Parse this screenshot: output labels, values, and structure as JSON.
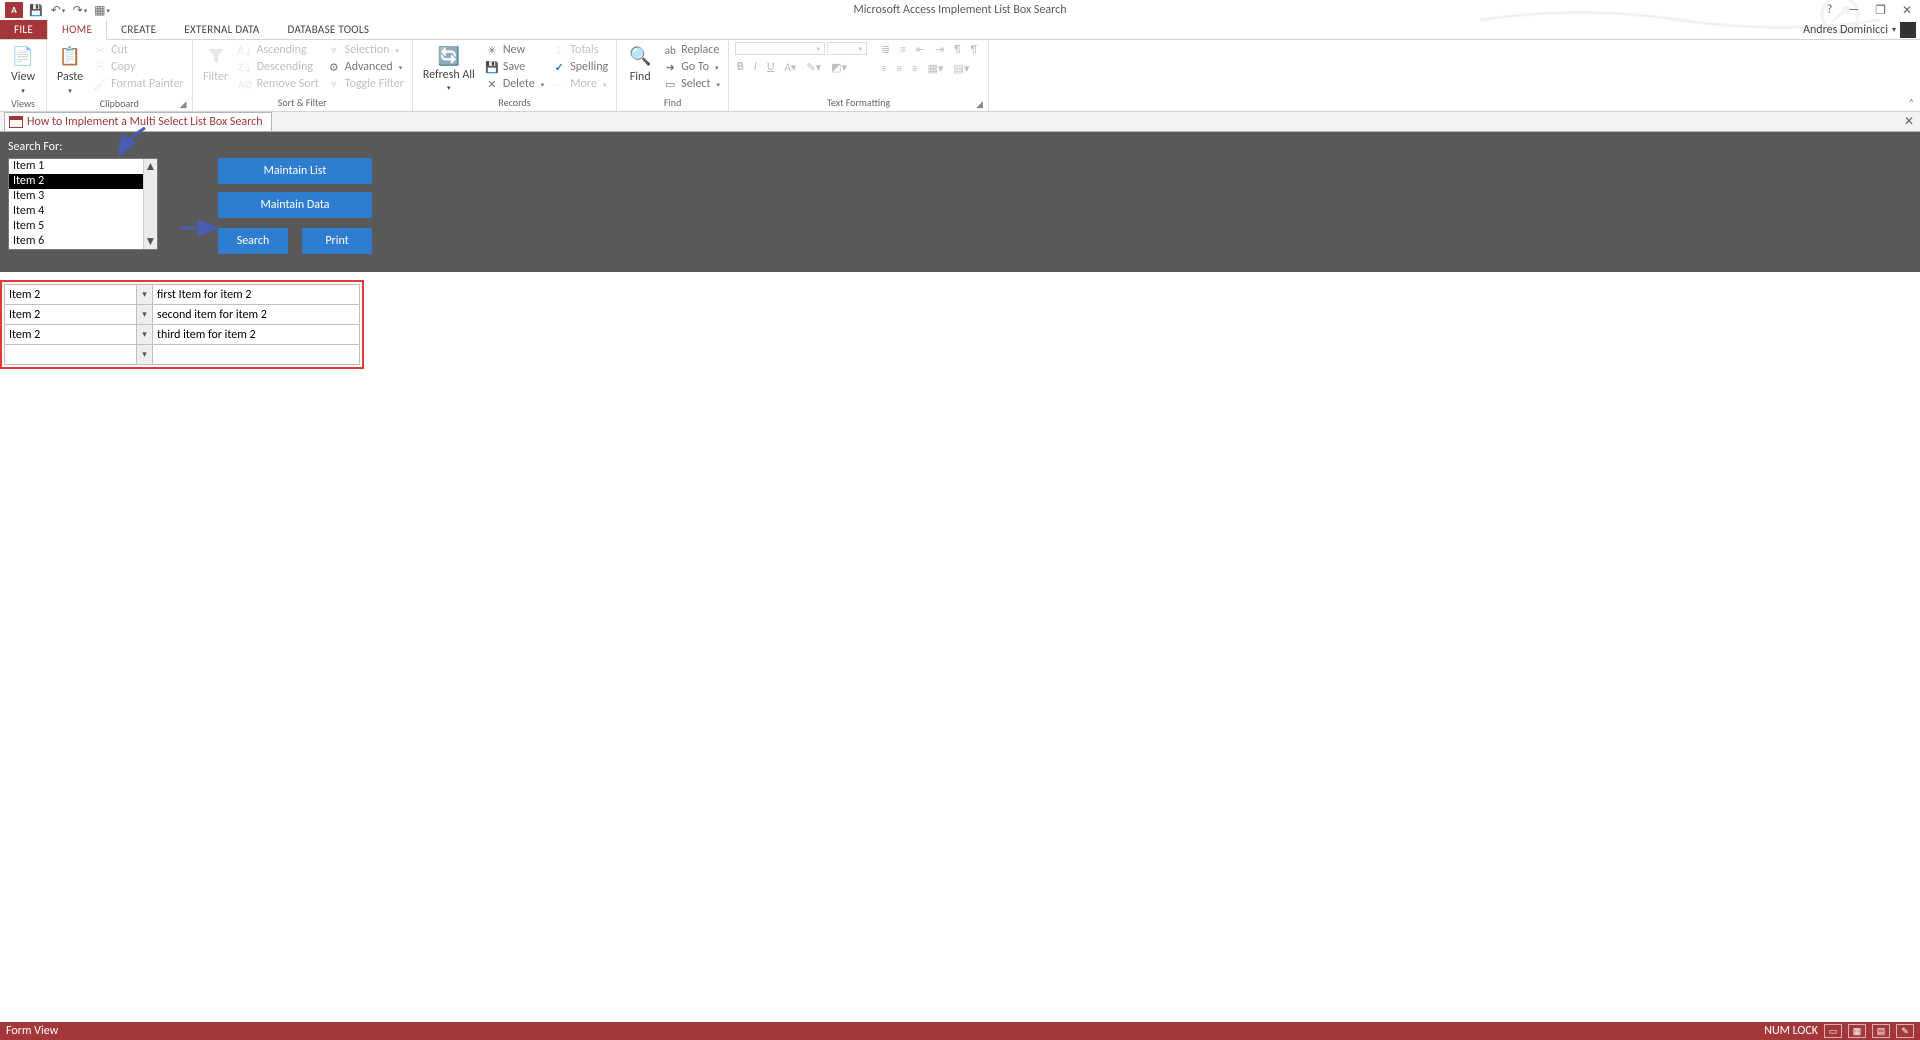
{
  "app": {
    "title": "Microsoft Access Implement List Box Search",
    "icon_label": "A"
  },
  "qat": {
    "save": "💾",
    "undo": "↶",
    "redo": "↷",
    "custom": "▦"
  },
  "win": {
    "help": "?",
    "min": "—",
    "restore": "❐",
    "close": "✕"
  },
  "user": {
    "name": "Andres Dominicci"
  },
  "tabs": {
    "file": "FILE",
    "home": "HOME",
    "create": "CREATE",
    "external": "EXTERNAL DATA",
    "dbtools": "DATABASE TOOLS"
  },
  "ribbon": {
    "views": {
      "view": "View",
      "group": "Views"
    },
    "clipboard": {
      "paste": "Paste",
      "cut": "Cut",
      "copy": "Copy",
      "fmt": "Format Painter",
      "group": "Clipboard"
    },
    "sortfilter": {
      "filter": "Filter",
      "asc": "Ascending",
      "desc": "Descending",
      "remove": "Remove Sort",
      "selection": "Selection",
      "advanced": "Advanced",
      "toggle": "Toggle Filter",
      "group": "Sort & Filter"
    },
    "records": {
      "refresh": "Refresh All",
      "new": "New",
      "save": "Save",
      "delete": "Delete",
      "totals": "Totals",
      "spelling": "Spelling",
      "more": "More",
      "group": "Records"
    },
    "find": {
      "find": "Find",
      "replace": "Replace",
      "goto": "Go To",
      "select": "Select",
      "group": "Find"
    },
    "textfmt": {
      "group": "Text Formatting"
    }
  },
  "doc_tab": {
    "title": "How to Implement a Multi Select List Box Search"
  },
  "form": {
    "search_label": "Search For:",
    "list_items": [
      "Item 1",
      "Item 2",
      "Item 3",
      "Item 4",
      "Item 5",
      "Item 6"
    ],
    "selected_index": 1,
    "btn_maintain_list": "Maintain List",
    "btn_maintain_data": "Maintain Data",
    "btn_search": "Search",
    "btn_print": "Print"
  },
  "results": {
    "rows": [
      {
        "combo": "Item 2",
        "desc": "first Item for item 2"
      },
      {
        "combo": "Item 2",
        "desc": "second item for item 2"
      },
      {
        "combo": "Item 2",
        "desc": "third item for item 2"
      },
      {
        "combo": "",
        "desc": ""
      }
    ]
  },
  "status": {
    "left": "Form View",
    "numlock": "NUM LOCK"
  }
}
